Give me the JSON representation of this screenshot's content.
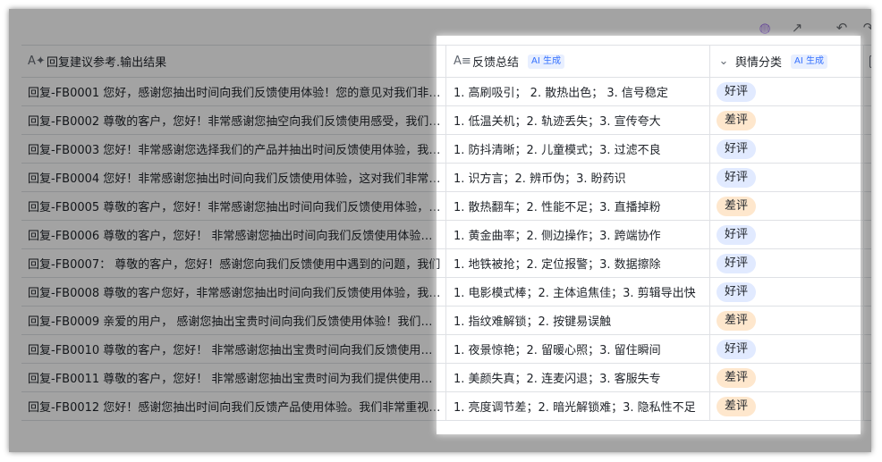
{
  "header": {
    "col1": "回复建议参考.输出结果",
    "col2": "反馈总结",
    "col3": "舆情分类",
    "ai_badge": "AI 生成"
  },
  "colors": {
    "good_tag": "#e1eaff",
    "bad_tag": "#fee7cd",
    "ai_badge": "#3370ff"
  },
  "rows": [
    {
      "reply": "回复-FB0001 您好，感谢您抽出时间向我们反馈使用体验！您的意见对我们非常重要",
      "summary": "1. 高刷吸引；  2. 散热出色；  3. 信号稳定",
      "sentiment": "好评",
      "kind": "good"
    },
    {
      "reply": "回复-FB0002 尊敬的客户，您好！非常感谢您抽空向我们反馈使用感受，我们已收到",
      "summary": "1. 低温关机；2. 轨迹丢失；3. 宣传夸大",
      "sentiment": "差评",
      "kind": "bad"
    },
    {
      "reply": "回复-FB0003 您好！非常感谢您选择我们的产品并抽出时间反馈使用体验，我们非常重视",
      "summary": "1. 防抖清晰；2. 儿童模式；3. 过滤不良",
      "sentiment": "好评",
      "kind": "good"
    },
    {
      "reply": "回复-FB0004 您好！非常感谢您抽出时间向我们反馈使用体验，这对我们非常重要",
      "summary": "1. 识方言；2. 辨币伪；3. 盼药识",
      "sentiment": "好评",
      "kind": "good"
    },
    {
      "reply": "回复-FB0005 尊敬的客户，您好！非常感谢您抽出时间向我们反馈使用体验，我们已收到",
      "summary": "1. 散热翻车；2. 性能不足；3. 直播掉粉",
      "sentiment": "差评",
      "kind": "bad"
    },
    {
      "reply": "回复-FB0006 尊敬的客户，您好！ 非常感谢您抽出时间向我们反馈使用体验，我们",
      "summary": "1. 黄金曲率；2. 侧边操作；3. 跨端协作",
      "sentiment": "好评",
      "kind": "good"
    },
    {
      "reply": "回复-FB0007： 尊敬的客户，您好！感谢您向我们反馈使用中遇到的问题，我们",
      "summary": "1. 地铁被抢；2. 定位报警；3. 数据擦除",
      "sentiment": "好评",
      "kind": "good"
    },
    {
      "reply": "回复-FB0008 尊敬的客户您好，非常感谢您抽出时间向我们反馈使用体验，我们已",
      "summary": "1. 电影模式棒；2. 主体追焦佳；3. 剪辑导出快",
      "sentiment": "好评",
      "kind": "good"
    },
    {
      "reply": "回复-FB0009 亲爱的用户， 感谢您抽出宝贵时间向我们反馈使用体验！我们非常",
      "summary": "1. 指纹难解锁；2. 按键易误触",
      "sentiment": "差评",
      "kind": "bad"
    },
    {
      "reply": "回复-FB0010 尊敬的客户，您好！ 非常感谢您抽出宝贵时间向我们反馈使用体验",
      "summary": "1. 夜景惊艳；2. 留暖心照；3. 留住瞬间",
      "sentiment": "好评",
      "kind": "good"
    },
    {
      "reply": "回复-FB0011 尊敬的客户，您好！ 非常感谢您抽出宝贵时间为我们提供使用反馈",
      "summary": "1. 美颜失真；2. 连麦闪退；3. 客服失专",
      "sentiment": "差评",
      "kind": "bad"
    },
    {
      "reply": "回复-FB0012 您好！感谢您抽出时间向我们反馈产品使用体验。我们非常重视您的意见",
      "summary": "1. 亮度调节差；2. 暗光解锁难；3. 隐私性不足",
      "sentiment": "差评",
      "kind": "bad"
    }
  ]
}
